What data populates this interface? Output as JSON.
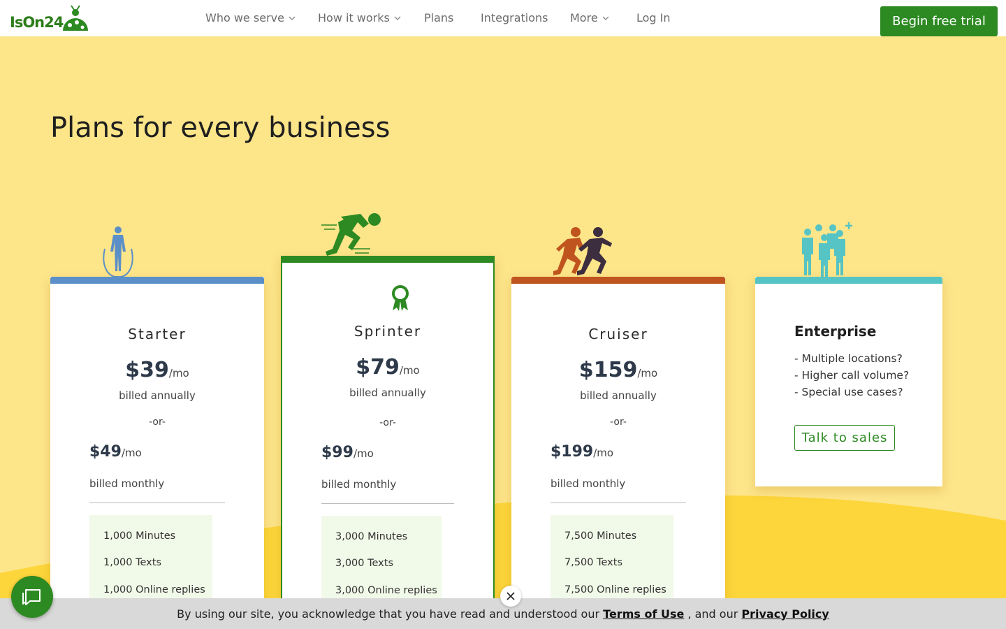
{
  "brand": {
    "logo_text": "IsOn24",
    "accent": "#2d8a22"
  },
  "nav": {
    "items": [
      {
        "label": "Who we serve",
        "has_dropdown": true
      },
      {
        "label": "How it works",
        "has_dropdown": true
      },
      {
        "label": "Plans",
        "has_dropdown": false
      },
      {
        "label": "Integrations",
        "has_dropdown": false
      },
      {
        "label": "More",
        "has_dropdown": true
      },
      {
        "label": "Log In",
        "has_dropdown": false
      }
    ],
    "cta": "Begin free trial"
  },
  "page": {
    "title": "Plans for every business"
  },
  "plans": [
    {
      "name": "Starter",
      "color": "#5b8fc7",
      "icon": "jump-rope-icon",
      "annual_price": "$39",
      "per": "/mo",
      "annual_note": "billed annually",
      "or": "-or-",
      "monthly_price": "$49",
      "monthly_note": "billed monthly",
      "features": [
        "1,000 Minutes",
        "1,000 Texts",
        "1,000 Online replies"
      ]
    },
    {
      "name": "Sprinter",
      "color": "#2d8a22",
      "icon": "sprinter-icon",
      "badge": "award-ribbon-icon",
      "annual_price": "$79",
      "per": "/mo",
      "annual_note": "billed annually",
      "or": "-or-",
      "monthly_price": "$99",
      "monthly_note": "billed monthly",
      "features": [
        "3,000 Minutes",
        "3,000 Texts",
        "3,000 Online replies"
      ]
    },
    {
      "name": "Cruiser",
      "color": "#c0541f",
      "icon": "runners-icon",
      "annual_price": "$159",
      "per": "/mo",
      "annual_note": "billed annually",
      "or": "-or-",
      "monthly_price": "$199",
      "monthly_note": "billed monthly",
      "features": [
        "7,500 Minutes",
        "7,500 Texts",
        "7,500 Online replies"
      ]
    }
  ],
  "enterprise": {
    "name": "Enterprise",
    "color": "#56c4c4",
    "icon": "team-plus-icon",
    "lines": [
      "- Multiple locations?",
      "- Higher call volume?",
      "- Special use cases?"
    ],
    "cta": "Talk to sales"
  },
  "cookie": {
    "text_before": "By using our site, you acknowledge that you have read and understood our",
    "terms": "Terms of Use",
    "text_mid": ", and our",
    "privacy": "Privacy Policy"
  }
}
